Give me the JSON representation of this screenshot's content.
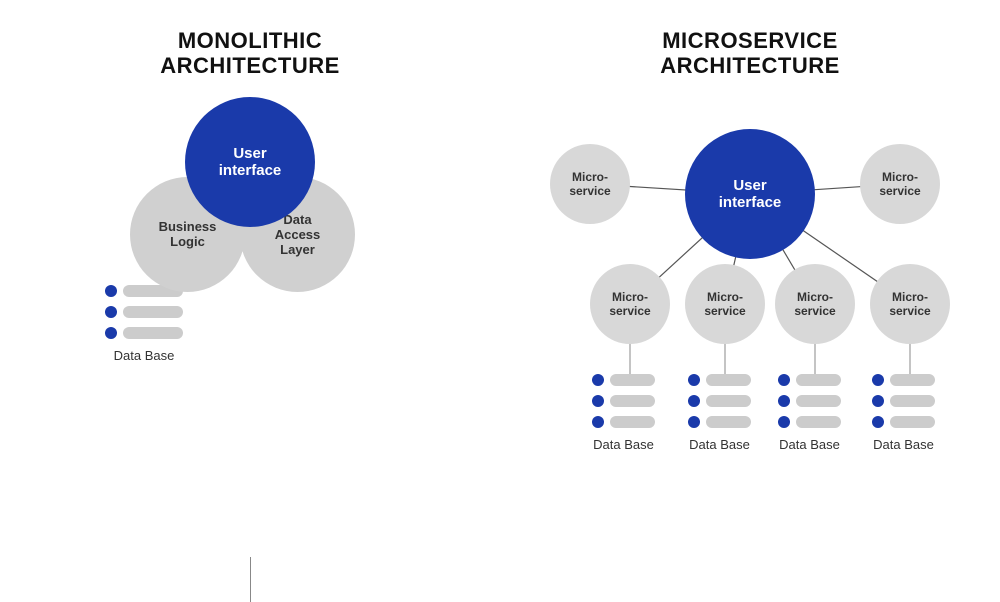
{
  "monolithic": {
    "title": "MONOLITHIC\nARCHITECTURE",
    "ui_label": "User\ninterface",
    "bl_label": "Business\nLogic",
    "dal_label": "Data\nAccess\nLayer",
    "db_label": "Data Base"
  },
  "microservice": {
    "title": "MICROSERVICE\nARCHITECTURE",
    "ui_label": "User\ninterface",
    "node_label": "Micro-\nservice",
    "db_label": "Data Base"
  }
}
